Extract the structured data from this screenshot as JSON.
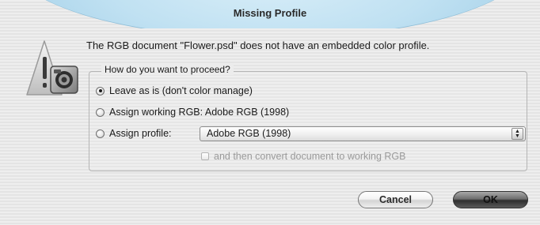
{
  "window": {
    "title": "Missing Profile"
  },
  "message": "The RGB document \"Flower.psd\" does not have an embedded color profile.",
  "icon": {
    "name": "alert-caution-icon"
  },
  "group": {
    "legend": "How do you want to proceed?",
    "options": [
      {
        "label": "Leave as is (don't color manage)",
        "checked": true
      },
      {
        "label": "Assign working RGB:  Adobe RGB (1998)",
        "checked": false
      },
      {
        "label": "Assign profile:",
        "checked": false
      }
    ],
    "profile_select": {
      "value": "Adobe RGB (1998)"
    },
    "convert_checkbox": {
      "label": "and then convert document to working RGB",
      "checked": false,
      "enabled": false
    }
  },
  "buttons": {
    "cancel": "Cancel",
    "ok": "OK"
  },
  "colors": {
    "title_bar": "#bfe0f1",
    "default_button": "#4a4a4a",
    "disabled_text": "#9a9a9a"
  }
}
